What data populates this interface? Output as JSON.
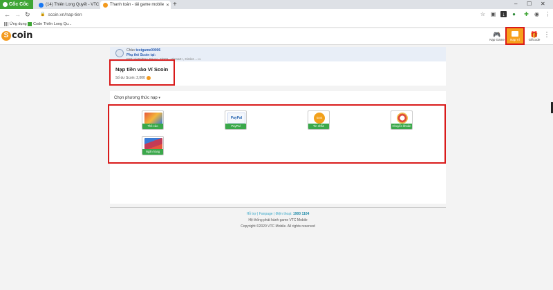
{
  "browser": {
    "brand": "Cốc Cốc",
    "tabs": [
      {
        "label": "(14) Thiên Long Quyết - VTC",
        "favicon_color": "#1877f2"
      },
      {
        "label": "Thanh toán - tải game mobile",
        "favicon_color": "#f39a1e"
      }
    ],
    "new_tab": "+",
    "address": "scoin.vn/nap-tien",
    "bookmarks": [
      {
        "label": "Ứng dụng",
        "icon": "apps-grid-icon"
      },
      {
        "label": "Code Thiên Long Qu...",
        "icon": "bookmark-favicon"
      }
    ]
  },
  "site": {
    "logo_text": "coin",
    "logo_letter": "S",
    "nav": [
      {
        "label": "Nạp Game",
        "icon": "gamepad-icon"
      },
      {
        "label": "Nạp Ví",
        "icon": "wallet-icon"
      },
      {
        "label": "Giftcode",
        "icon": "gift-icon"
      }
    ]
  },
  "user": {
    "greeting": "Chào",
    "username": "testgame00006",
    "info_title": "Phụ thẻ Scoin tại:",
    "info_line": "FPT, ViettelPay, Payoo, 7/OOL, Vinmart+, Circlet ... ↦"
  },
  "wallet": {
    "title": "Nạp tiền vào Ví Scoin",
    "balance_label": "Số dư Scoin: 2,000"
  },
  "methods": {
    "label": "Chọn phương thức nạp",
    "caret": "▾",
    "items": [
      {
        "label": "Thẻ cào",
        "color": "#e6573c"
      },
      {
        "label": "PayPal",
        "color": "#1f5fae"
      },
      {
        "label": "Tin nhắn",
        "color": "#f2a11c"
      },
      {
        "label": "Chuyển khoản",
        "color": "#e04a3a"
      },
      {
        "label": "Ngân hàng",
        "color": "#c43b55"
      }
    ]
  },
  "footer": {
    "links": "Hỗ trợ | Fanpage | Điện thoại:",
    "phone": "1900 1104",
    "line2": "Hệ thống phát hành game VTC Mobile",
    "line3": "Copyright ©2020 VTC Mobile. All rights reserved"
  },
  "colors": {
    "accent": "#f7a01c",
    "highlight": "#d91a1a",
    "green": "#3aa84a"
  }
}
